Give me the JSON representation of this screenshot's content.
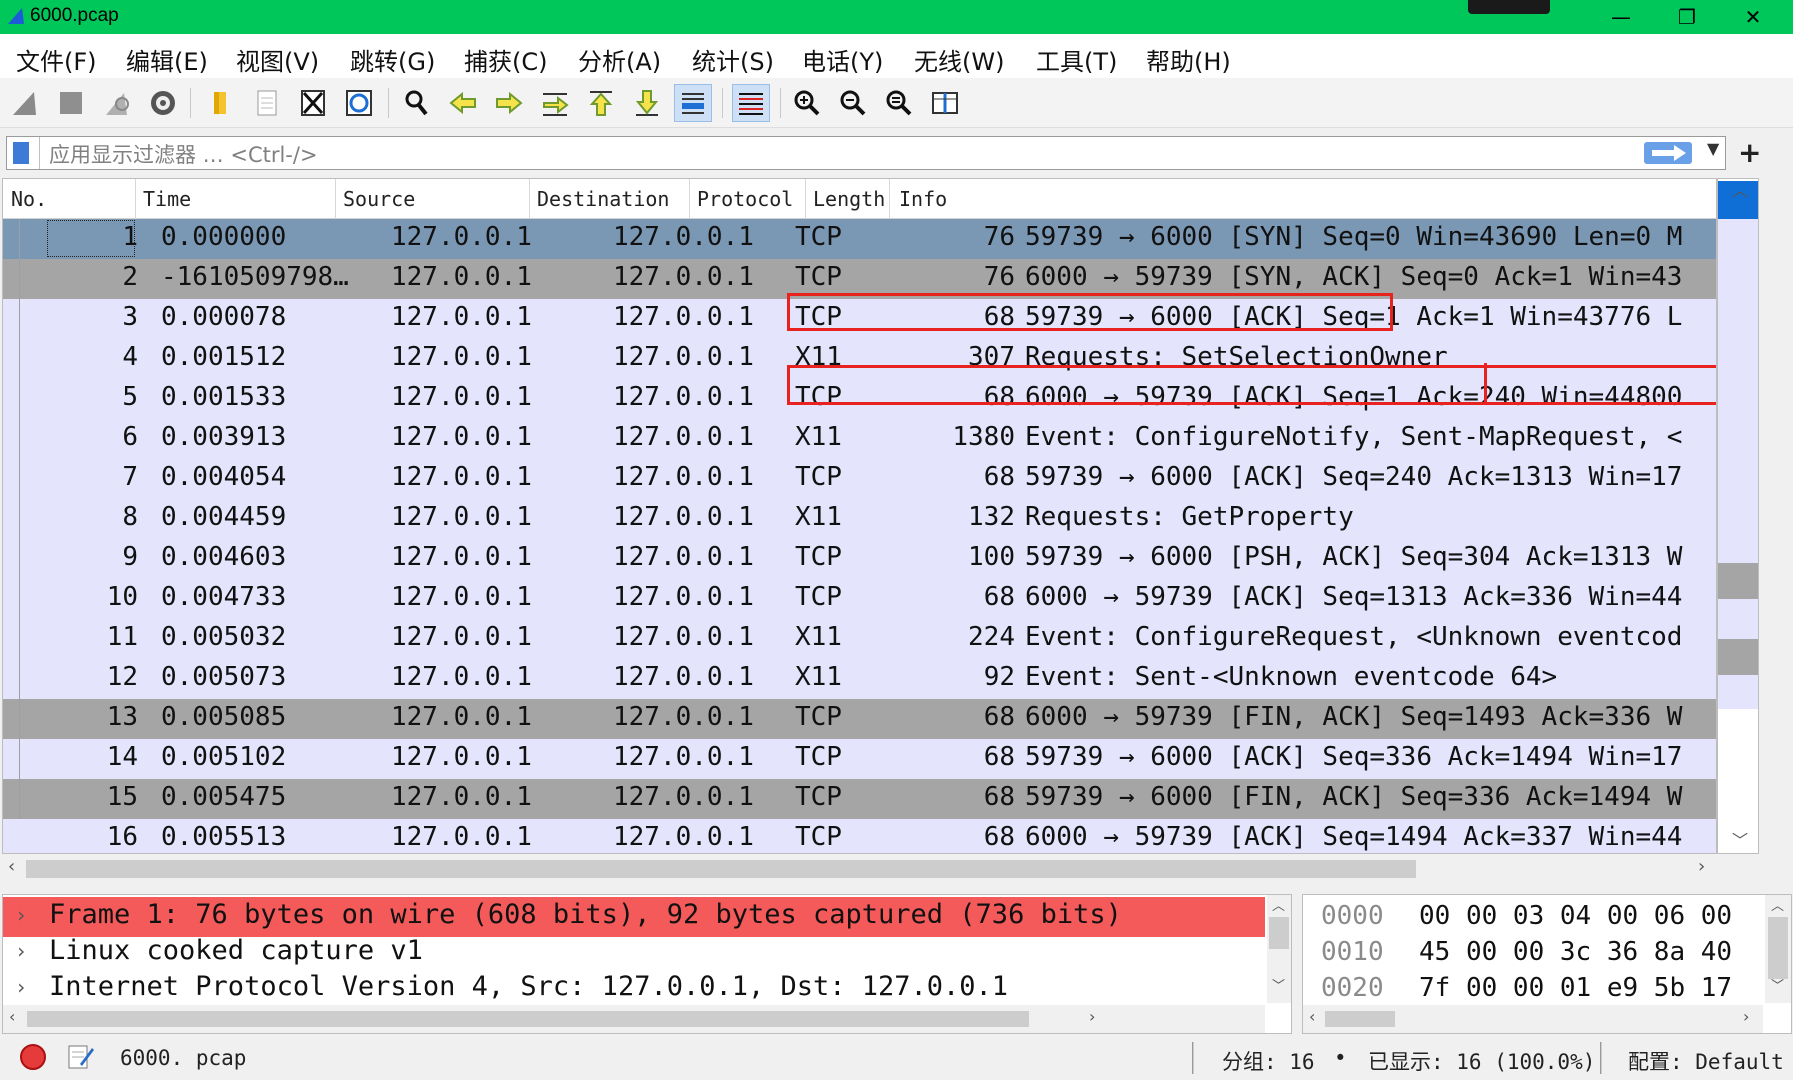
{
  "window": {
    "title": "6000.pcap",
    "minimize": "—",
    "restore": "❐",
    "close": "✕"
  },
  "menu": [
    "文件(F)",
    "编辑(E)",
    "视图(V)",
    "跳转(G)",
    "捕获(C)",
    "分析(A)",
    "统计(S)",
    "电话(Y)",
    "无线(W)",
    "工具(T)",
    "帮助(H)"
  ],
  "toolbar": {
    "icons": [
      "shark-fin-start-icon",
      "stop-capture-icon",
      "restart-capture-icon",
      "capture-options-icon",
      "open-file-icon",
      "save-file-icon",
      "close-file-icon",
      "reload-file-icon",
      "find-packet-icon",
      "go-back-icon",
      "go-forward-icon",
      "go-to-packet-icon",
      "go-first-packet-icon",
      "go-last-packet-icon",
      "auto-scroll-icon",
      "colorize-icon",
      "zoom-in-icon",
      "zoom-out-icon",
      "zoom-normal-icon",
      "resize-columns-icon"
    ]
  },
  "filter": {
    "placeholder": "应用显示过滤器 … <Ctrl-/>",
    "add": "+"
  },
  "packet_list": {
    "columns": [
      "No.",
      "Time",
      "Source",
      "Destination",
      "Protocol",
      "Length",
      "Info"
    ],
    "rows": [
      {
        "no": "1",
        "time": "0.000000",
        "src": "127.0.0.1",
        "dst": "127.0.0.1",
        "proto": "TCP",
        "len": "76",
        "info": "59739 → 6000 [SYN] Seq=0 Win=43690 Len=0 M",
        "style": "selected"
      },
      {
        "no": "2",
        "time": "-1610509798…",
        "src": "127.0.0.1",
        "dst": "127.0.0.1",
        "proto": "TCP",
        "len": "76",
        "info": "6000 → 59739 [SYN, ACK] Seq=0 Ack=1 Win=43",
        "style": "gray"
      },
      {
        "no": "3",
        "time": "0.000078",
        "src": "127.0.0.1",
        "dst": "127.0.0.1",
        "proto": "TCP",
        "len": "68",
        "info": "59739 → 6000 [ACK] Seq=1 Ack=1 Win=43776 L",
        "style": "lavender"
      },
      {
        "no": "4",
        "time": "0.001512",
        "src": "127.0.0.1",
        "dst": "127.0.0.1",
        "proto": "X11",
        "len": "307",
        "info": "Requests: SetSelectionOwner",
        "style": "lavender"
      },
      {
        "no": "5",
        "time": "0.001533",
        "src": "127.0.0.1",
        "dst": "127.0.0.1",
        "proto": "TCP",
        "len": "68",
        "info": "6000 → 59739 [ACK] Seq=1 Ack=240 Win=44800",
        "style": "lavender"
      },
      {
        "no": "6",
        "time": "0.003913",
        "src": "127.0.0.1",
        "dst": "127.0.0.1",
        "proto": "X11",
        "len": "1380",
        "info": "Event: ConfigureNotify, Sent-MapRequest, <",
        "style": "lavender"
      },
      {
        "no": "7",
        "time": "0.004054",
        "src": "127.0.0.1",
        "dst": "127.0.0.1",
        "proto": "TCP",
        "len": "68",
        "info": "59739 → 6000 [ACK] Seq=240 Ack=1313 Win=17",
        "style": "lavender"
      },
      {
        "no": "8",
        "time": "0.004459",
        "src": "127.0.0.1",
        "dst": "127.0.0.1",
        "proto": "X11",
        "len": "132",
        "info": "Requests: GetProperty",
        "style": "lavender"
      },
      {
        "no": "9",
        "time": "0.004603",
        "src": "127.0.0.1",
        "dst": "127.0.0.1",
        "proto": "TCP",
        "len": "100",
        "info": "59739 → 6000 [PSH, ACK] Seq=304 Ack=1313 W",
        "style": "lavender"
      },
      {
        "no": "10",
        "time": "0.004733",
        "src": "127.0.0.1",
        "dst": "127.0.0.1",
        "proto": "TCP",
        "len": "68",
        "info": "6000 → 59739 [ACK] Seq=1313 Ack=336 Win=44",
        "style": "lavender"
      },
      {
        "no": "11",
        "time": "0.005032",
        "src": "127.0.0.1",
        "dst": "127.0.0.1",
        "proto": "X11",
        "len": "224",
        "info": "Event: ConfigureRequest, <Unknown eventcod",
        "style": "lavender"
      },
      {
        "no": "12",
        "time": "0.005073",
        "src": "127.0.0.1",
        "dst": "127.0.0.1",
        "proto": "X11",
        "len": "92",
        "info": "Event: Sent-<Unknown eventcode 64>",
        "style": "lavender"
      },
      {
        "no": "13",
        "time": "0.005085",
        "src": "127.0.0.1",
        "dst": "127.0.0.1",
        "proto": "TCP",
        "len": "68",
        "info": "6000 → 59739 [FIN, ACK] Seq=1493 Ack=336 W",
        "style": "gray"
      },
      {
        "no": "14",
        "time": "0.005102",
        "src": "127.0.0.1",
        "dst": "127.0.0.1",
        "proto": "TCP",
        "len": "68",
        "info": "59739 → 6000 [ACK] Seq=336 Ack=1494 Win=17",
        "style": "lavender"
      },
      {
        "no": "15",
        "time": "0.005475",
        "src": "127.0.0.1",
        "dst": "127.0.0.1",
        "proto": "TCP",
        "len": "68",
        "info": "59739 → 6000 [FIN, ACK] Seq=336 Ack=1494 W",
        "style": "gray"
      },
      {
        "no": "16",
        "time": "0.005513",
        "src": "127.0.0.1",
        "dst": "127.0.0.1",
        "proto": "TCP",
        "len": "68",
        "info": "6000 → 59739 [ACK] Seq=1494 Ack=337 Win=44",
        "style": "lavender"
      }
    ]
  },
  "details": [
    {
      "text": "Frame 1: 76 bytes on wire (608 bits), 92 bytes captured (736 bits)",
      "highlight": true
    },
    {
      "text": "Linux cooked capture v1",
      "highlight": false
    },
    {
      "text": "Internet Protocol Version 4, Src: 127.0.0.1, Dst: 127.0.0.1",
      "highlight": false
    }
  ],
  "bytes": [
    {
      "offset": "0000",
      "hex": "00 00 03 04 00 06 00"
    },
    {
      "offset": "0010",
      "hex": "45 00 00 3c 36 8a 40"
    },
    {
      "offset": "0020",
      "hex": "7f 00 00 01 e9 5b 17"
    }
  ],
  "status": {
    "file": "6000. pcap",
    "packets": "分组: 16",
    "displayed": "已显示: 16 (100.0%)",
    "profile": "配置: Default"
  },
  "colors": {
    "titlebar": "#00c75a",
    "row_selected": "#7a97b4",
    "row_gray": "#a5a5a5",
    "row_lavender": "#e4e4fc",
    "detail_highlight": "#f45a5a",
    "annotation_box": "#e8221f"
  }
}
